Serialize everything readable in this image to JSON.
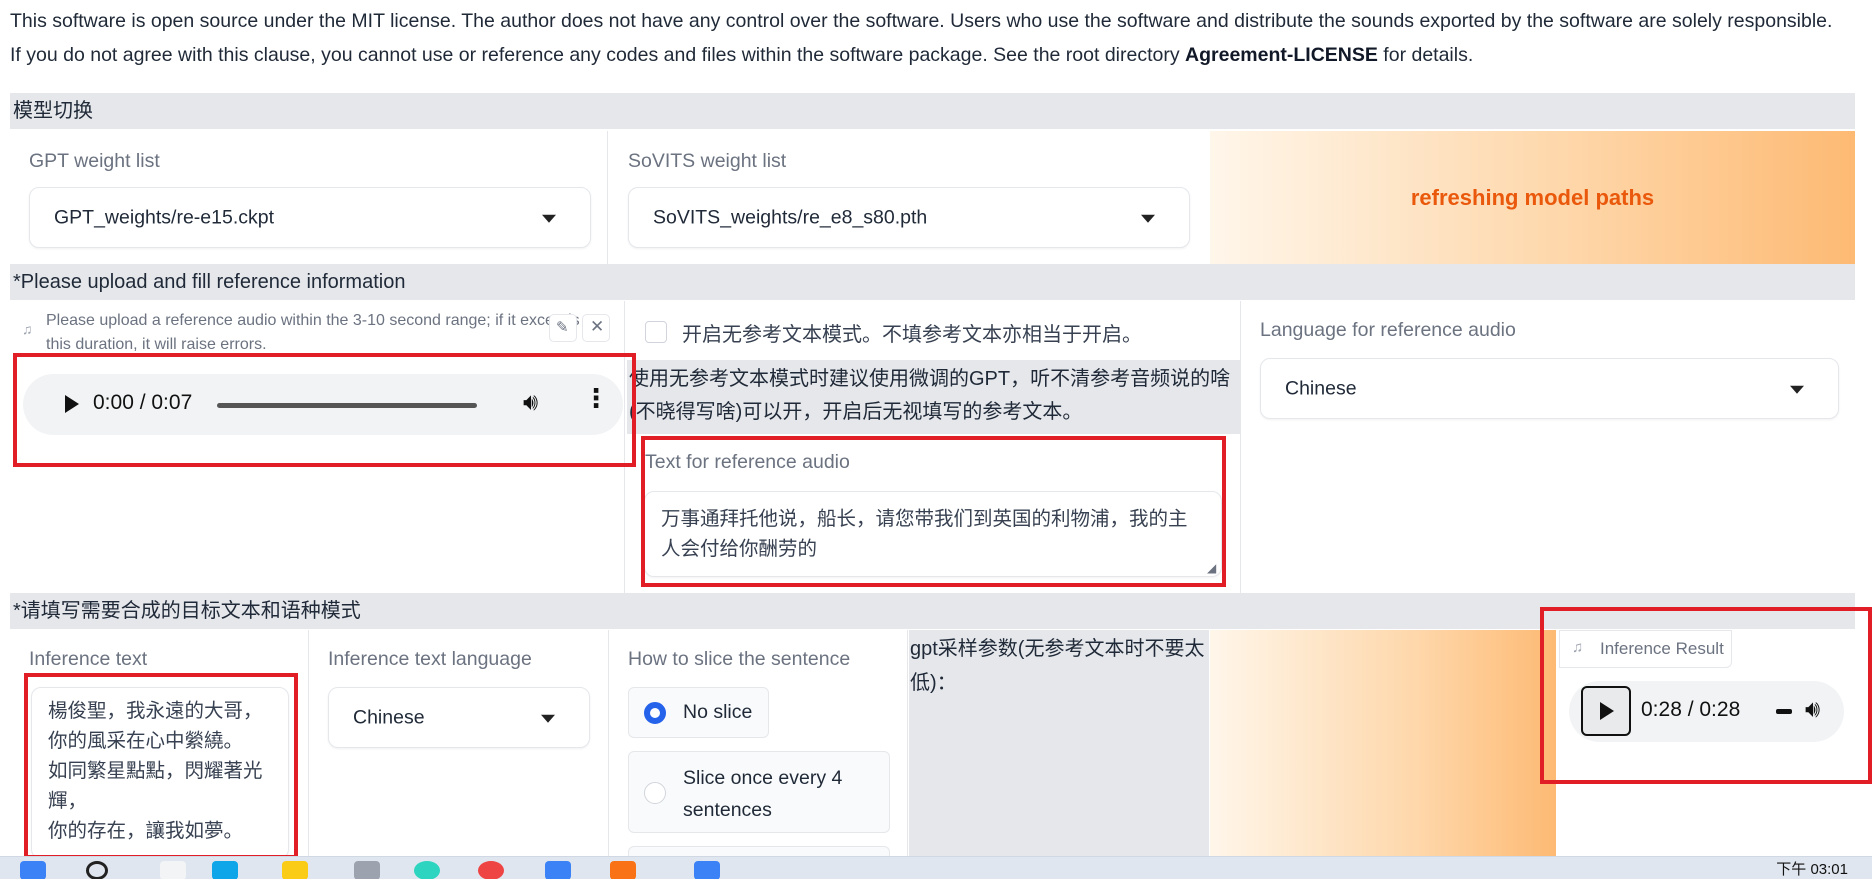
{
  "license": {
    "line1": "This software is open source under the MIT license. The author does not have any control over the software. Users who use the software and distribute the sounds exported by the software are solely responsible.",
    "line2_pre": "If you do not agree with this clause, you cannot use or reference any codes and files within the software package. See the root directory ",
    "line2_bold": "Agreement-LICENSE",
    "line2_post": " for details."
  },
  "model_section": {
    "title": "模型切换",
    "gpt_label": "GPT weight list",
    "gpt_value": "GPT_weights/re-e15.ckpt",
    "sovits_label": "SoVITS weight list",
    "sovits_value": "SoVITS_weights/re_e8_s80.pth",
    "refresh_label": "refreshing model paths"
  },
  "reference_section": {
    "title": "*Please upload and fill reference information",
    "upload_hint": "Please upload a reference audio within the 3-10 second range; if it exceeds this duration, it will raise errors.",
    "audio_time": "0:00 / 0:07",
    "audio_progress": 0,
    "no_ref_checkbox_label": "开启无参考文本模式。不填参考文本亦相当于开启。",
    "no_ref_checked": false,
    "no_ref_note": "使用无参考文本模式时建议使用微调的GPT，听不清参考音频说的啥(不晓得写啥)可以开，开启后无视填写的参考文本。",
    "ref_text_label": "Text for reference audio",
    "ref_text_value": "万事通拜托他说，船长，请您带我们到英国的利物浦，我的主人会付给你酬劳的",
    "ref_lang_label": "Language for reference audio",
    "ref_lang_value": "Chinese"
  },
  "target_section": {
    "title": "*请填写需要合成的目标文本和语种模式",
    "inference_text_label": "Inference text",
    "inference_text_value": "楊俊聖，我永遠的大哥，\n你的風采在心中縈繞。\n如同繁星點點，閃耀著光輝，\n你的存在，讓我如夢。",
    "inference_lang_label": "Inference text language",
    "inference_lang_value": "Chinese",
    "slice_label": "How to slice the sentence",
    "slice_options": [
      "No slice",
      "Slice once every 4 sentences"
    ],
    "slice_selected": "No slice",
    "gpt_params_label": "gpt采样参数(无参考文本时不要太低)：",
    "result_label": "Inference Result",
    "result_time": "0:28 / 0:28"
  },
  "taskbar": {
    "clock": "下午 03:01"
  },
  "colors": {
    "accent_orange": "#ea580c",
    "radio_blue": "#2563eb",
    "annotation_red": "#e11d26"
  }
}
